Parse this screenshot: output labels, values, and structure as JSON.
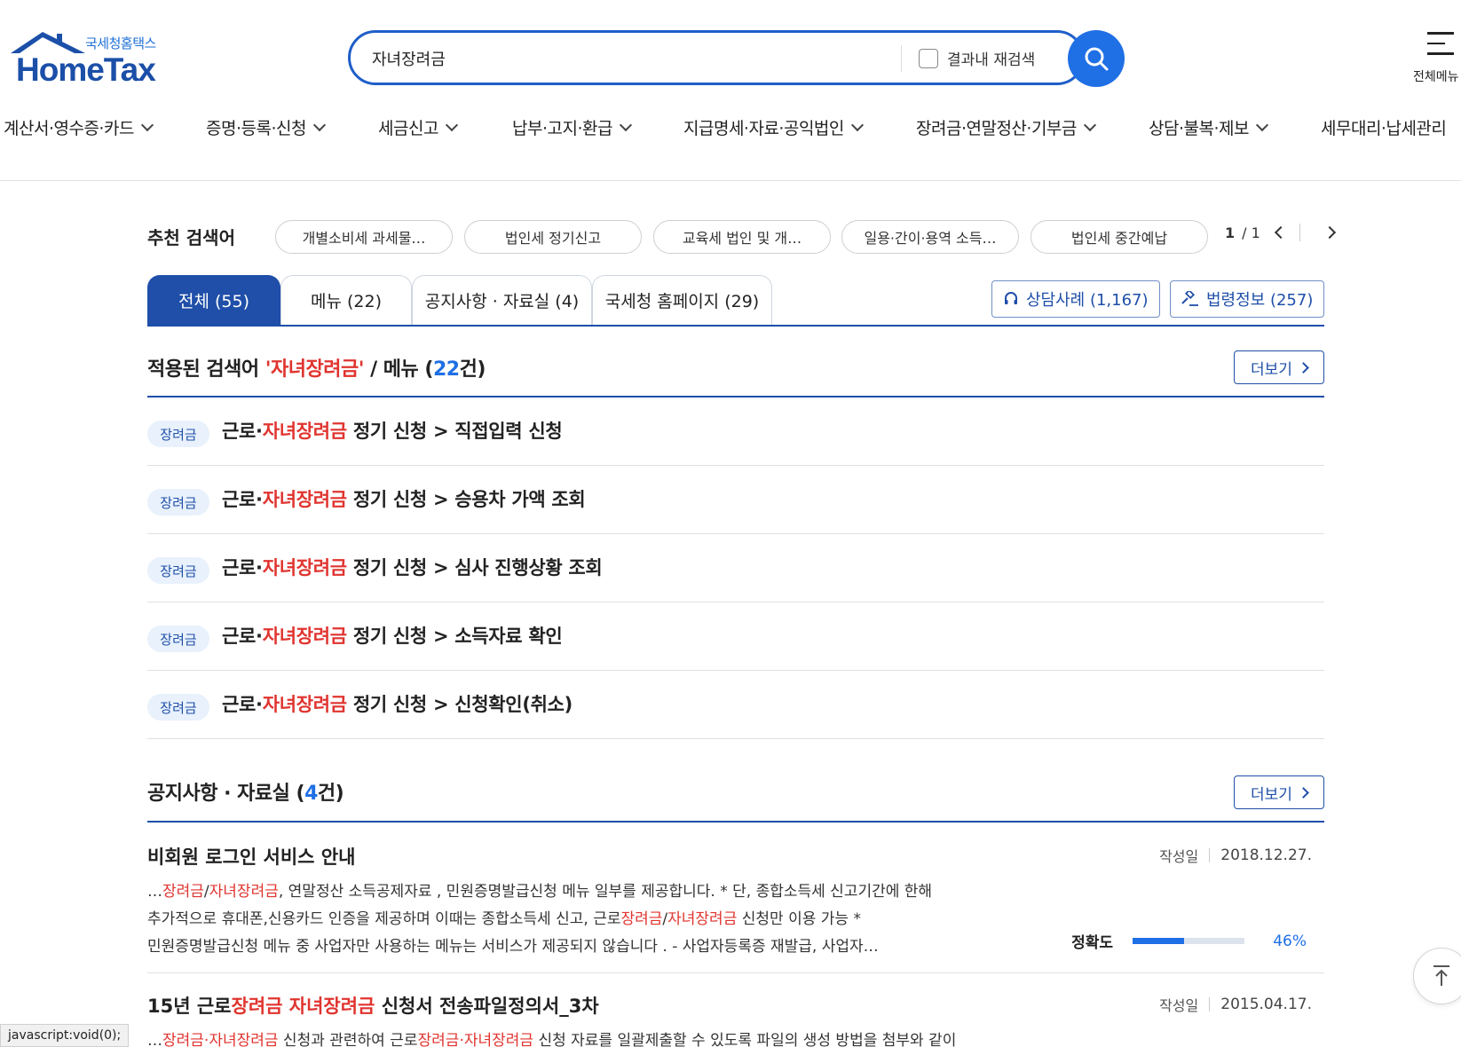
{
  "logo": {
    "small": "국세청홈택스",
    "big": "HomeTax"
  },
  "search": {
    "value": "자녀장려금",
    "recheck_label": "결과내 재검색"
  },
  "allmenu_label": "전체메뉴",
  "gnb": [
    {
      "label": "계산서·영수증·카드"
    },
    {
      "label": "증명·등록·신청"
    },
    {
      "label": "세금신고"
    },
    {
      "label": "납부·고지·환급"
    },
    {
      "label": "지급명세·자료·공익법인"
    },
    {
      "label": "장려금·연말정산·기부금"
    },
    {
      "label": "상담·불복·제보"
    },
    {
      "label": "세무대리·납세관리"
    }
  ],
  "recommended": {
    "title": "추천 검색어",
    "chips": [
      "개별소비세 과세물…",
      "법인세 정기신고",
      "교육세 법인 및 개…",
      "일용·간이·용역 소득…",
      "법인세 중간예납"
    ],
    "page_current": "1",
    "page_total": "/ 1"
  },
  "tabs": [
    {
      "label": "전체 (55)",
      "active": true
    },
    {
      "label": "메뉴 (22)",
      "active": false
    },
    {
      "label": "공지사항 · 자료실 (4)",
      "active": false
    },
    {
      "label": "국세청 홈페이지 (29)",
      "active": false
    }
  ],
  "tools": {
    "consult": "상담사례 (1,167)",
    "law": "법령정보 (257)"
  },
  "menu_section": {
    "prefix": "적용된 검색어 ",
    "keyword": "'자녀장려금'",
    "middle": " / 메뉴 (",
    "count": "22",
    "suffix": "건)",
    "more": "더보기",
    "rows": [
      {
        "badge": "장려금",
        "pre": "근로·",
        "hl": "자녀장려금",
        "post": " 정기 신청 > 직접입력 신청"
      },
      {
        "badge": "장려금",
        "pre": "근로·",
        "hl": "자녀장려금",
        "post": " 정기 신청 > 승용차 가액 조회"
      },
      {
        "badge": "장려금",
        "pre": "근로·",
        "hl": "자녀장려금",
        "post": " 정기 신청 > 심사 진행상황 조회"
      },
      {
        "badge": "장려금",
        "pre": "근로·",
        "hl": "자녀장려금",
        "post": " 정기 신청 > 소득자료 확인"
      },
      {
        "badge": "장려금",
        "pre": "근로·",
        "hl": "자녀장려금",
        "post": " 정기 신청 > 신청확인(취소)"
      }
    ]
  },
  "notice_section": {
    "title": "공지사항 · 자료실 (",
    "count": "4",
    "suffix": "건)",
    "more": "더보기",
    "items": [
      {
        "title_plain": "비회원 로그인 서비스 안내",
        "date_label": "작성일",
        "date": "2018.12.27.",
        "line1": [
          "…",
          "장려금",
          "/",
          "자녀장려금",
          ", 연말정산 소득공제자료 , 민원증명발급신청 메뉴 일부를 제공합니다. * 단, 종합소득세 신고기간에 한해"
        ],
        "line2": [
          "추가적으로 휴대폰,신용카드 인증을 제공하며 이때는 종합소득세 신고, 근로",
          "장려금",
          "/",
          "자녀장려금",
          " 신청만 이용 가능 *"
        ],
        "line3": "민원증명발급신청 메뉴 중 사업자만 사용하는 메뉴는 서비스가 제공되지 않습니다 . - 사업자등록증 재발급, 사업자…",
        "accuracy_label": "정확도",
        "accuracy": "46%",
        "accuracy_value": 0.46
      },
      {
        "title_parts": [
          "15년 근로",
          "장려금",
          " ",
          "자녀장려금",
          " 신청서 전송파일정의서_3차"
        ],
        "date_label": "작성일",
        "date": "2015.04.17.",
        "line1": [
          "…",
          "장려금",
          "·",
          "자녀장려금",
          " 신청과 관련하여 근로",
          "장려금",
          "·",
          "자녀장려금",
          " 신청 자료를 일괄제출할 수 있도록 파일의 생성 방법을 첨부와 같이"
        ]
      }
    ]
  },
  "status_bar": "javascript:void(0);",
  "colors": {
    "primary": "#1f4fa8",
    "accent": "#1f6fe5",
    "highlight": "#e0342f"
  }
}
